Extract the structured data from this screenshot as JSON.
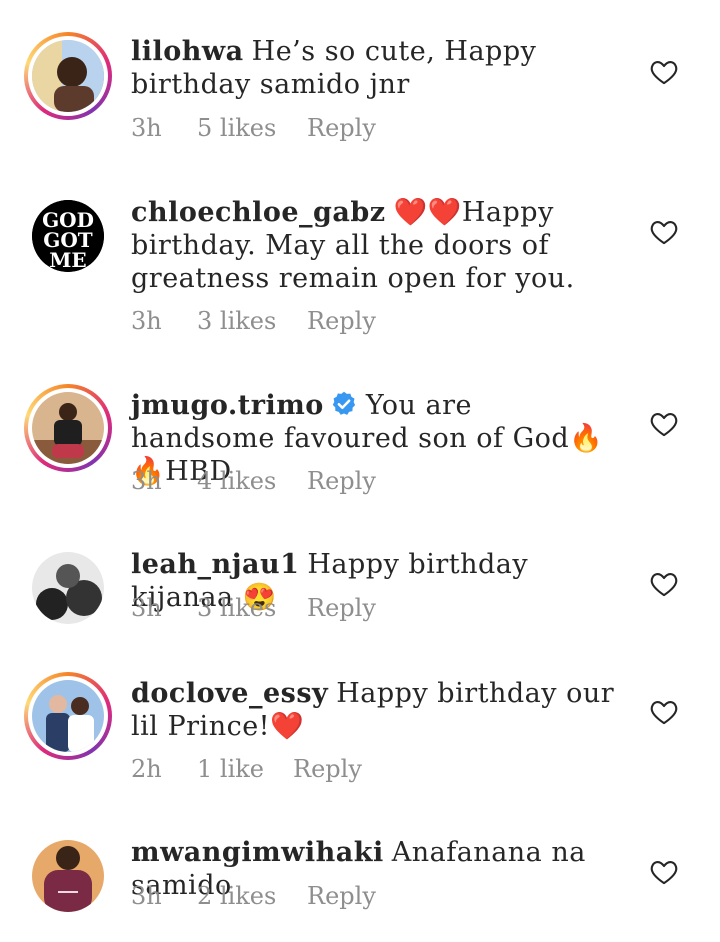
{
  "comments": [
    {
      "username": "lilohwa",
      "text": "He’s so cute, Happy birthday samido jnr",
      "time": "3h",
      "likes": "5 likes",
      "reply": "Reply",
      "verified": false,
      "avatar_ring": true
    },
    {
      "username": "chloechloe_gabz",
      "text": "❤️❤️Happy birthday. May all the doors of greatness remain open for you.",
      "time": "3h",
      "likes": "3 likes",
      "reply": "Reply",
      "verified": false,
      "avatar_ring": false,
      "avatar_text": "GOD GOT ME"
    },
    {
      "username": "jmugo.trimo",
      "text": "You are handsome favoured  son of God🔥🔥HBD",
      "time": "3h",
      "likes": "4 likes",
      "reply": "Reply",
      "verified": true,
      "avatar_ring": true
    },
    {
      "username": "leah_njau1",
      "text": "Happy birthday kijanaa 😍",
      "time": "3h",
      "likes": "3 likes",
      "reply": "Reply",
      "verified": false,
      "avatar_ring": false
    },
    {
      "username": "doclove_essy",
      "text": "Happy birthday our lil Prince!❤️",
      "time": "2h",
      "likes": "1 like",
      "reply": "Reply",
      "verified": false,
      "avatar_ring": true
    },
    {
      "username": "mwangimwihaki",
      "text": "Anafanana na samido",
      "time": "3h",
      "likes": "2 likes",
      "reply": "Reply",
      "verified": false,
      "avatar_ring": false
    }
  ],
  "colors": {
    "text": "#262626",
    "meta": "#8e8e8e",
    "verified_blue": "#3897f0"
  },
  "icons": {
    "like": "heart-outline-icon",
    "verified": "verified-badge-icon"
  }
}
